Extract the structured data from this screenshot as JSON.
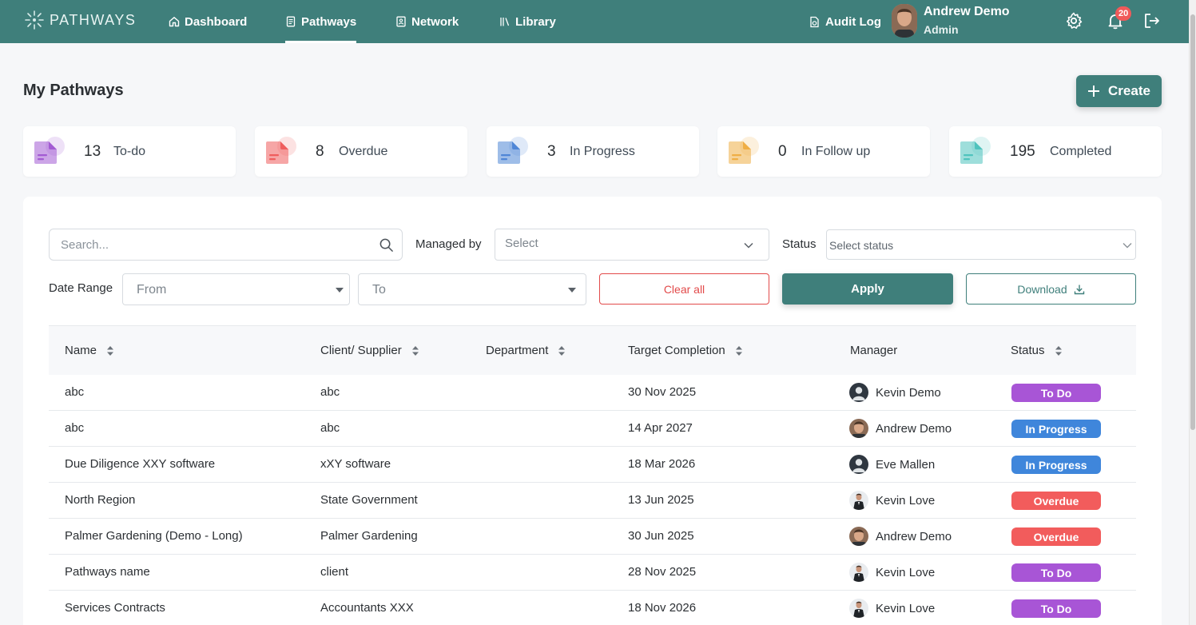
{
  "app": {
    "brand": "PATHWAYS",
    "nav": [
      {
        "label": "Dashboard",
        "icon": "home-icon"
      },
      {
        "label": "Pathways",
        "icon": "document-icon",
        "active": true
      },
      {
        "label": "Network",
        "icon": "contact-card-icon"
      },
      {
        "label": "Library",
        "icon": "library-icon"
      }
    ],
    "audit_log": "Audit Log",
    "user": {
      "name": "Andrew Demo",
      "role": "Admin"
    },
    "notifications_count": "20"
  },
  "page": {
    "title": "My Pathways",
    "create_label": "Create"
  },
  "stats": [
    {
      "count": "13",
      "label": "To-do",
      "color": "#a35bd3"
    },
    {
      "count": "8",
      "label": "Overdue",
      "color": "#ef5d5d"
    },
    {
      "count": "3",
      "label": "In Progress",
      "color": "#4f86d6"
    },
    {
      "count": "0",
      "label": "In Follow up",
      "color": "#efae45"
    },
    {
      "count": "195",
      "label": "Completed",
      "color": "#4fc3bd"
    }
  ],
  "filters": {
    "search_placeholder": "Search...",
    "managed_by_label": "Managed by",
    "managed_by_value": "Select",
    "status_label": "Status",
    "status_value": "Select status",
    "date_range_label": "Date Range",
    "from_value": "From",
    "to_value": "To",
    "clear_label": "Clear all",
    "apply_label": "Apply",
    "download_label": "Download"
  },
  "table": {
    "columns": [
      "Name",
      "Client/ Supplier",
      "Department",
      "Target Completion",
      "Manager",
      "Status"
    ],
    "rows": [
      {
        "name": "abc",
        "client": "abc",
        "department": "",
        "target": "30 Nov 2025",
        "manager": "Kevin Demo",
        "avatar": "generic",
        "status": "To Do"
      },
      {
        "name": "abc",
        "client": "abc",
        "department": "",
        "target": "14 Apr 2027",
        "manager": "Andrew Demo",
        "avatar": "andrew",
        "status": "In Progress"
      },
      {
        "name": "Due Diligence XXY software",
        "client": "xXY software",
        "department": "",
        "target": "18 Mar 2026",
        "manager": "Eve Mallen",
        "avatar": "generic",
        "status": "In Progress"
      },
      {
        "name": "North Region",
        "client": "State Government",
        "department": "",
        "target": "13 Jun 2025",
        "manager": "Kevin Love",
        "avatar": "suit",
        "status": "Overdue"
      },
      {
        "name": "Palmer Gardening (Demo - Long)",
        "client": "Palmer Gardening",
        "department": "",
        "target": "30 Jun 2025",
        "manager": "Andrew Demo",
        "avatar": "andrew",
        "status": "Overdue"
      },
      {
        "name": "Pathways name",
        "client": "client",
        "department": "",
        "target": "28 Nov 2025",
        "manager": "Kevin Love",
        "avatar": "suit",
        "status": "To Do"
      },
      {
        "name": "Services Contracts",
        "client": "Accountants XXX",
        "department": "",
        "target": "18 Nov 2026",
        "manager": "Kevin Love",
        "avatar": "suit",
        "status": "To Do"
      }
    ]
  },
  "status_colors": {
    "To Do": "#a855d6",
    "In Progress": "#3f86db",
    "Overdue": "#f25c5c"
  },
  "colors": {
    "brand": "#3f7f7b",
    "danger": "#e24a4a"
  }
}
